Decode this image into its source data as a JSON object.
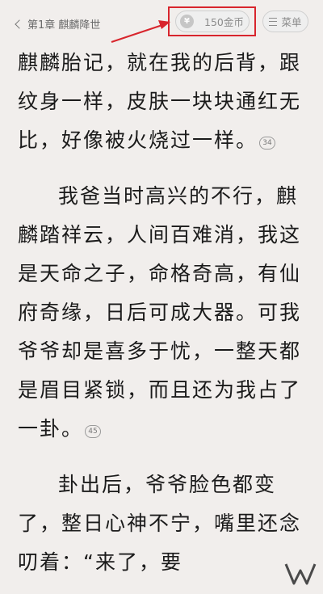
{
  "header": {
    "chapter_title": "第1章 麒麟降世",
    "coin_icon_glyph": "¥",
    "coins_label": "150金币",
    "menu_label": "菜单"
  },
  "annotation": {
    "highlight_color": "#d8252d"
  },
  "content": {
    "paragraphs": [
      {
        "lines": [
          "麒麟胎记，就在我的后背，",
          "跟纹身一样，皮肤一块块通",
          "红无比，好像被火烧过一",
          "样。"
        ],
        "note": "34"
      },
      {
        "lines": [
          "我爸当时高兴的不行，",
          "麒麟踏祥云，人间百难消，",
          "我这是天命之子，命格奇",
          "高，有仙府奇缘，日后可成",
          "大器。可我爷爷却是喜多于",
          "忧，一整天都是眉目紧锁，",
          "而且还为我占了一卦。"
        ],
        "note": "45"
      },
      {
        "lines": [
          "卦出后，爷爷脸色都变",
          "了，整日心神不宁，嘴里还",
          "念叨着：“来了，要"
        ]
      }
    ]
  }
}
